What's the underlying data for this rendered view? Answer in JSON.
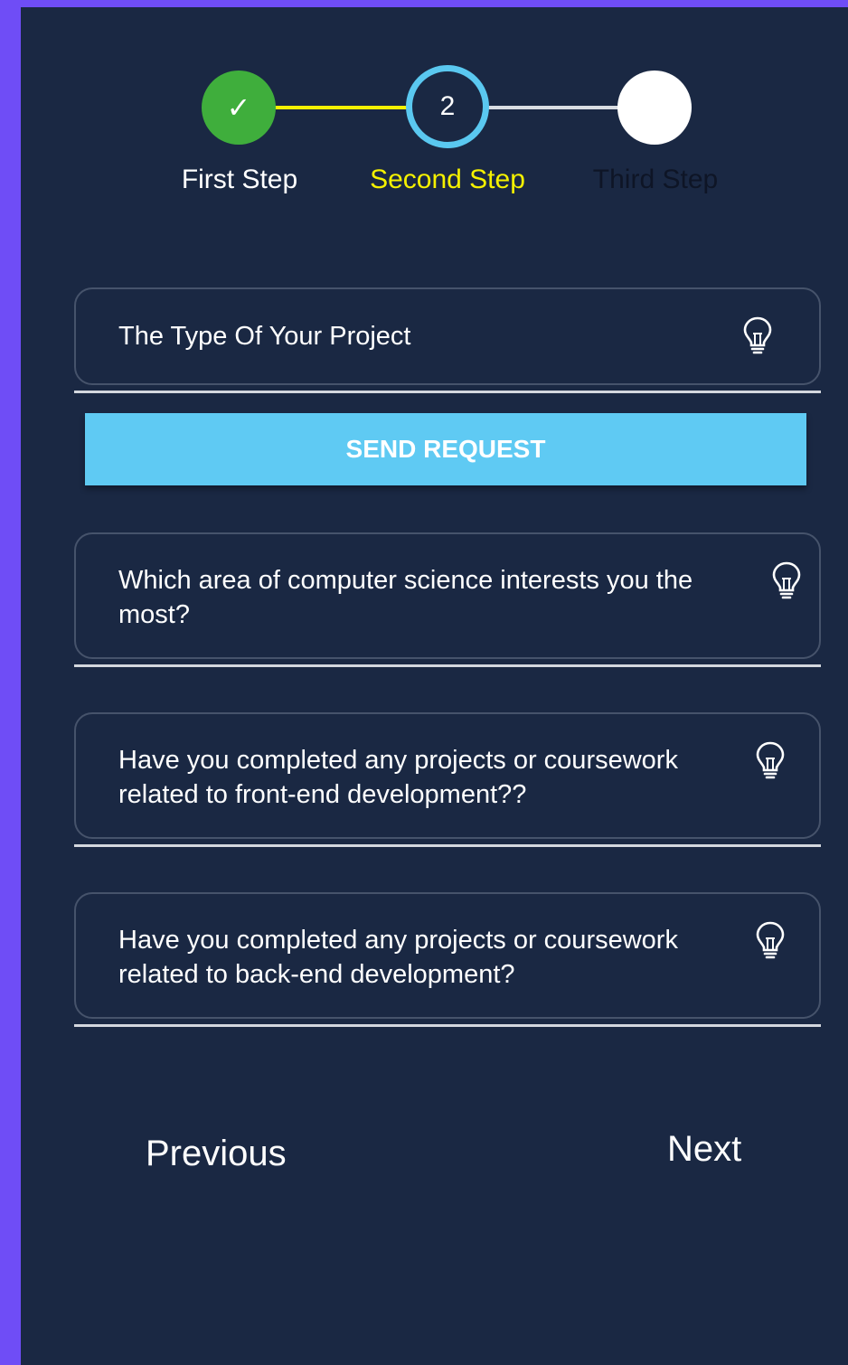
{
  "stepper": {
    "steps": [
      {
        "label": "First Step",
        "status": "completed",
        "glyph": "✓",
        "color": "#3fae3c"
      },
      {
        "label": "Second Step",
        "status": "active",
        "number": "2",
        "color": "#5ac8f0"
      },
      {
        "label": "Third Step",
        "status": "pending",
        "color": "#ffffff"
      }
    ]
  },
  "form": {
    "project_type_placeholder": "The Type Of Your Project",
    "send_request_label": "SEND REQUEST",
    "questions": [
      "Which area of computer science interests you the most?",
      "Have you completed any projects or coursework related to front-end development??",
      "Have you completed any projects or coursework related to back-end development?"
    ],
    "field_icon": "lightbulb-icon"
  },
  "nav": {
    "previous_label": "Previous",
    "next_label": "Next"
  },
  "colors": {
    "background": "#1a2843",
    "frame": "#6f4df6",
    "accent_yellow": "#f5f100",
    "button_blue": "#5fcaf3"
  }
}
